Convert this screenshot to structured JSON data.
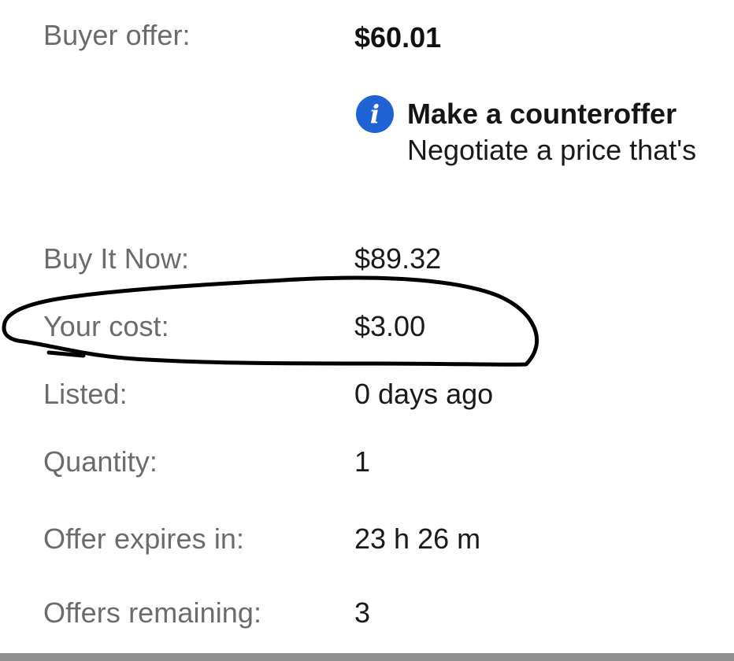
{
  "rows": {
    "buyer_offer": {
      "label": "Buyer offer:",
      "value": "$60.01"
    },
    "buy_it_now": {
      "label": "Buy It Now:",
      "value": "$89.32"
    },
    "your_cost": {
      "label": "Your cost:",
      "value": "$3.00"
    },
    "listed": {
      "label": "Listed:",
      "value": "0 days ago"
    },
    "quantity": {
      "label": "Quantity:",
      "value": "1"
    },
    "offer_expires": {
      "label": "Offer expires in:",
      "value": "23 h 26 m"
    },
    "offers_remaining": {
      "label": "Offers remaining:",
      "value": "3"
    }
  },
  "counteroffer": {
    "icon": "info-icon",
    "icon_glyph": "i",
    "title": "Make a counteroffer",
    "subtitle": "Negotiate a price that's"
  },
  "colors": {
    "label": "#6b6b6b",
    "value": "#1a1a1a",
    "info_icon": "#1f62d3",
    "annotation": "#000000"
  }
}
